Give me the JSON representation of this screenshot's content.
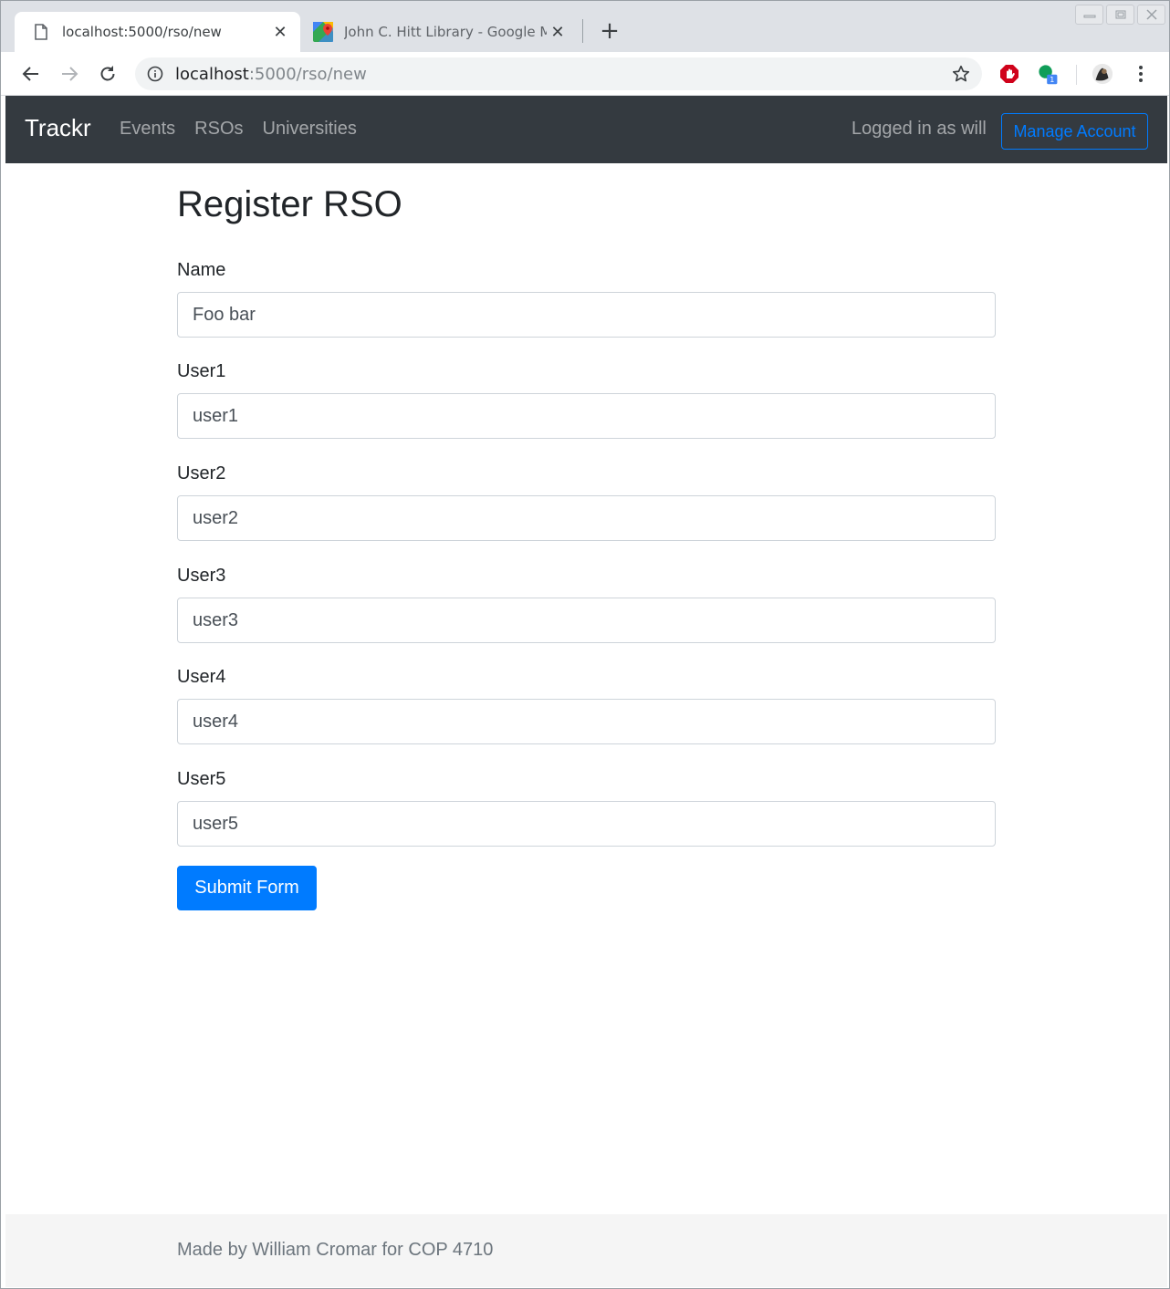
{
  "browser": {
    "tabs": [
      {
        "title": "localhost:5000/rso/new",
        "icon": "document-icon",
        "active": true
      },
      {
        "title": "John C. Hitt Library - Google Ma",
        "icon": "google-maps-icon",
        "active": false
      }
    ],
    "address": {
      "host": "localhost",
      "path": ":5000/rso/new"
    },
    "extension_badge": "1"
  },
  "navbar": {
    "brand": "Trackr",
    "links": [
      "Events",
      "RSOs",
      "Universities"
    ],
    "logged_in_text": "Logged in as will",
    "manage_button": "Manage Account"
  },
  "form": {
    "title": "Register RSO",
    "fields": [
      {
        "label": "Name",
        "value": "Foo bar"
      },
      {
        "label": "User1",
        "value": "user1"
      },
      {
        "label": "User2",
        "value": "user2"
      },
      {
        "label": "User3",
        "value": "user3"
      },
      {
        "label": "User4",
        "value": "user4"
      },
      {
        "label": "User5",
        "value": "user5"
      }
    ],
    "submit_label": "Submit Form"
  },
  "footer": {
    "text": "Made by William Cromar for COP 4710"
  },
  "colors": {
    "navbar": "#343a40",
    "primary": "#007bff",
    "footer_bg": "#f5f5f5"
  }
}
